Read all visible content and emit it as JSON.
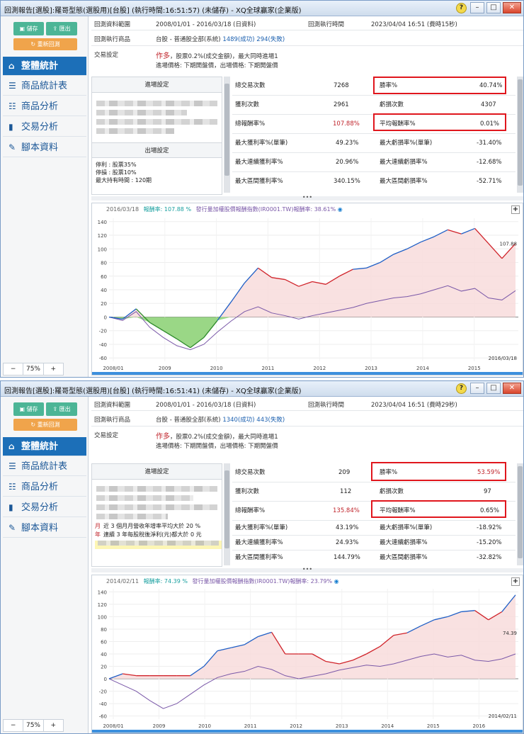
{
  "windows": [
    {
      "title": "回測報告[選股]:羅哥型態(選股用)[台股] (執行時間:16:51:57) (未儲存) - XQ全球贏家(企業版)",
      "toolbar": {
        "save": "儲存",
        "export": "匯出",
        "rerun": "重新回測"
      },
      "nav": [
        "整體統計",
        "商品統計表",
        "商品分析",
        "交易分析",
        "腳本資料"
      ],
      "zoom": {
        "minus": "−",
        "level": "75%",
        "plus": "+"
      },
      "info": {
        "range_label": "回測資料範圍",
        "range_value": "2008/01/01 - 2016/03/18 (日資料)",
        "exec_label": "回測執行時間",
        "exec_value": "2023/04/04 16:51 (費時15秒)",
        "product_label": "回測執行商品",
        "product_value": "台股 - 普通股全部(系統)",
        "product_success": "1489(成功)",
        "product_fail": "294(失敗)",
        "trade_label": "交易設定",
        "trade_dir": "作多",
        "trade_line1": "，股票0.2%(成交金額)，最大同時進場1",
        "trade_line2": "進場價格: 下期開盤價，出場價格: 下期開盤價"
      },
      "settings": {
        "entry_head": "進場設定",
        "exit_head": "出場設定",
        "exit_lines": [
          "停利 : 股票35%",
          "停損 : 股票10%",
          "最大持有時間 : 120期"
        ]
      },
      "stats": {
        "total_trades": "總交易次數",
        "total_trades_v": "7268",
        "win_rate": "勝率%",
        "win_rate_v": "40.74%",
        "win_count": "獲利次數",
        "win_count_v": "2961",
        "loss_count": "虧損次數",
        "loss_count_v": "4307",
        "total_return": "總報酬率%",
        "total_return_v": "107.88%",
        "avg_return": "平均報酬率%",
        "avg_return_v": "0.01%",
        "max_win": "最大獲利率%(單筆)",
        "max_win_v": "49.23%",
        "max_loss": "最大虧損率%(單筆)",
        "max_loss_v": "-31.40%",
        "max_consec_win": "最大連續獲利率%",
        "max_consec_win_v": "20.96%",
        "max_consec_loss": "最大連續虧損率%",
        "max_consec_loss_v": "-12.68%",
        "max_range_win": "最大區間獲利率%",
        "max_range_win_v": "340.15%",
        "max_range_loss": "最大區間虧損率%",
        "max_range_loss_v": "-52.71%"
      },
      "chart_data": {
        "type": "line",
        "date": "2016/03/18",
        "legend_return_label": "報酬率:",
        "legend_return": "107.88 %",
        "legend_bench_label": "發行量加權股價報酬指數(IR0001.TW)報酬率:",
        "legend_bench": "38.61%",
        "y_ticks": [
          "140",
          "120",
          "100",
          "80",
          "60",
          "40",
          "20",
          "0",
          "-20",
          "-40",
          "-60"
        ],
        "ylim": [
          -65,
          145
        ],
        "x_ticks": [
          "2008/01",
          "2009",
          "2010",
          "2011",
          "2012",
          "2013",
          "2014",
          "2015"
        ],
        "end_value": "107.88",
        "end_date": "2016/03/18",
        "series": [
          {
            "name": "報酬率",
            "values": [
              0,
              -3,
              12,
              -8,
              -20,
              -32,
              -45,
              -30,
              -5,
              22,
              50,
              72,
              58,
              55,
              45,
              52,
              48,
              60,
              70,
              72,
              80,
              92,
              100,
              110,
              118,
              128,
              122,
              130,
              108,
              86,
              107.88
            ]
          },
          {
            "name": "發行量加權股價報酬指數(IR0001.TW)報酬率",
            "values": [
              0,
              -5,
              8,
              -15,
              -30,
              -42,
              -48,
              -40,
              -22,
              -6,
              8,
              15,
              6,
              2,
              -3,
              2,
              6,
              10,
              14,
              20,
              24,
              28,
              30,
              34,
              40,
              46,
              38,
              42,
              28,
              25,
              38.61
            ]
          }
        ]
      }
    },
    {
      "title": "回測報告[選股]:羅哥型態(選股用)[台股] (執行時間:16:51:41) (未儲存) - XQ全球贏家(企業版)",
      "toolbar": {
        "save": "儲存",
        "export": "匯出",
        "rerun": "重新回測"
      },
      "nav": [
        "整體統計",
        "商品統計表",
        "商品分析",
        "交易分析",
        "腳本資料"
      ],
      "zoom": {
        "minus": "−",
        "level": "75%",
        "plus": "+"
      },
      "info": {
        "range_label": "回測資料範圍",
        "range_value": "2008/01/01 - 2016/03/18 (日資料)",
        "exec_label": "回測執行時間",
        "exec_value": "2023/04/04 16:51 (費時29秒)",
        "product_label": "回測執行商品",
        "product_value": "台股 - 普通股全部(系統)",
        "product_success": "1340(成功)",
        "product_fail": "443(失敗)",
        "trade_label": "交易設定",
        "trade_dir": "作多",
        "trade_line1": "，股票0.2%(成交金額)，最大同時進場1",
        "trade_line2": "進場價格: 下期開盤價，出場價格: 下期開盤價"
      },
      "settings": {
        "entry_head": "進場設定",
        "cond_month": "月",
        "cond_year": "年",
        "cond1": "近 3 個月月營收年增率平均大於 20 %",
        "cond2": "連續 3 年每股稅後淨利(元)都大於 0 元"
      },
      "stats": {
        "total_trades": "總交易次數",
        "total_trades_v": "209",
        "win_rate": "勝率%",
        "win_rate_v": "53.59%",
        "win_count": "獲利次數",
        "win_count_v": "112",
        "loss_count": "虧損次數",
        "loss_count_v": "97",
        "total_return": "總報酬率%",
        "total_return_v": "135.84%",
        "avg_return": "平均報酬率%",
        "avg_return_v": "0.65%",
        "max_win": "最大獲利率%(單筆)",
        "max_win_v": "43.19%",
        "max_loss": "最大虧損率%(單筆)",
        "max_loss_v": "-18.92%",
        "max_consec_win": "最大連續獲利率%",
        "max_consec_win_v": "24.93%",
        "max_consec_loss": "最大連續虧損率%",
        "max_consec_loss_v": "-15.20%",
        "max_range_win": "最大區間獲利率%",
        "max_range_win_v": "144.79%",
        "max_range_loss": "最大區間虧損率%",
        "max_range_loss_v": "-32.82%"
      },
      "chart_data": {
        "type": "line",
        "date": "2014/02/11",
        "legend_return_label": "報酬率:",
        "legend_return": "74.39 %",
        "legend_bench_label": "發行量加權股價報酬指數(IR0001.TW)報酬率:",
        "legend_bench": "23.79%",
        "y_ticks": [
          "140",
          "120",
          "100",
          "80",
          "60",
          "40",
          "20",
          "0",
          "-20",
          "-40",
          "-60"
        ],
        "ylim": [
          -65,
          145
        ],
        "x_ticks": [
          "2008/01",
          "2009",
          "2010",
          "2011",
          "2012",
          "2013",
          "2014",
          "2015",
          "2016"
        ],
        "end_value": "74.39",
        "end_date": "2014/02/11",
        "series": [
          {
            "name": "報酬率",
            "values": [
              0,
              8,
              5,
              5,
              5,
              5,
              5,
              20,
              45,
              50,
              55,
              68,
              75,
              40,
              40,
              40,
              28,
              24,
              30,
              40,
              52,
              70,
              74,
              85,
              95,
              100,
              108,
              110,
              95,
              108,
              135
            ]
          },
          {
            "name": "發行量加權股價報酬指數(IR0001.TW)報酬率",
            "values": [
              0,
              -10,
              -20,
              -35,
              -48,
              -40,
              -25,
              -10,
              2,
              8,
              12,
              20,
              15,
              5,
              0,
              4,
              8,
              14,
              18,
              22,
              20,
              24,
              30,
              36,
              40,
              35,
              38,
              30,
              28,
              32,
              40
            ]
          }
        ]
      }
    }
  ],
  "colors": {
    "highlight": "#e0161d",
    "strategy": "#d0232a",
    "strategy_new_high": "#1f5fc6",
    "benchmark": "#7a58a8",
    "fill_pos": "#f7d9d9",
    "fill_neg": "#8fd67c",
    "nav_active": "#1c6fb8"
  }
}
